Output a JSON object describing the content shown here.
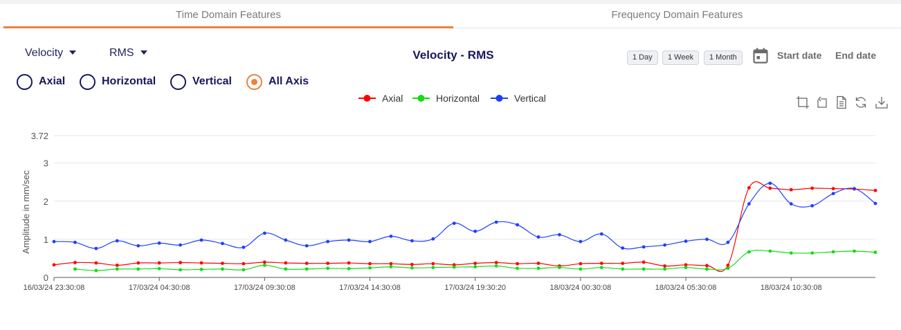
{
  "tabs": [
    {
      "label": "Time Domain Features"
    },
    {
      "label": "Frequency Domain Features"
    }
  ],
  "dropdowns": {
    "parameter": "Velocity",
    "feature": "RMS"
  },
  "chart_title": "Velocity - RMS",
  "range_buttons": [
    "1 Day",
    "1 Week",
    "1 Month"
  ],
  "date_range": {
    "start": "Start date",
    "end": "End date"
  },
  "axis_options": [
    {
      "label": "Axial",
      "selected": false
    },
    {
      "label": "Horizontal",
      "selected": false
    },
    {
      "label": "Vertical",
      "selected": false
    },
    {
      "label": "All Axis",
      "selected": true
    }
  ],
  "accent_color": "#e8833a",
  "toolbox": [
    "zoom-icon",
    "zoom-reset-icon",
    "data-view-icon",
    "restore-icon",
    "save-image-icon"
  ],
  "chart_data": {
    "type": "line",
    "ylabel": "Amplitude in mm/sec",
    "xlabel": "",
    "ylim": [
      0,
      3.72
    ],
    "yticks": [
      "0",
      "1",
      "2",
      "3",
      "3.72"
    ],
    "xticks": [
      "16/03/24 23:30:08",
      "17/03/24 04:30:08",
      "17/03/24 09:30:08",
      "17/03/24 14:30:08",
      "17/03/24 19:30:20",
      "18/03/24 00:30:08",
      "18/03/24 05:30:08",
      "18/03/24 10:30:08"
    ],
    "x_range_hours": [
      0,
      39
    ],
    "legend_position": "top-center",
    "grid": true,
    "smooth": true,
    "series": [
      {
        "name": "Axial",
        "color": "#ff0000",
        "x": [
          0,
          1,
          2,
          3,
          4,
          5,
          6,
          7,
          8,
          9,
          10,
          11,
          12,
          13,
          14,
          15,
          16,
          17,
          18,
          19,
          20,
          21,
          22,
          23,
          24,
          25,
          26,
          27,
          28,
          29,
          30,
          31,
          32,
          33,
          34,
          35,
          36,
          37,
          38,
          39
        ],
        "values": [
          0.33,
          0.39,
          0.38,
          0.32,
          0.38,
          0.38,
          0.39,
          0.38,
          0.37,
          0.36,
          0.4,
          0.38,
          0.37,
          0.37,
          0.38,
          0.36,
          0.36,
          0.34,
          0.36,
          0.33,
          0.37,
          0.39,
          0.36,
          0.37,
          0.3,
          0.36,
          0.37,
          0.37,
          0.4,
          0.3,
          0.33,
          0.31,
          0.32,
          2.35,
          2.34,
          2.3,
          2.34,
          2.33,
          2.32,
          2.28
        ]
      },
      {
        "name": "Horizontal",
        "color": "#11dd11",
        "x": [
          1,
          2,
          3,
          4,
          5,
          6,
          7,
          8,
          9,
          10,
          11,
          12,
          13,
          14,
          15,
          16,
          17,
          18,
          19,
          20,
          21,
          22,
          23,
          24,
          25,
          26,
          27,
          28,
          29,
          30,
          31,
          32,
          33,
          34,
          35,
          36,
          37,
          38,
          39
        ],
        "values": [
          0.22,
          0.18,
          0.22,
          0.22,
          0.23,
          0.2,
          0.21,
          0.22,
          0.2,
          0.32,
          0.22,
          0.22,
          0.24,
          0.23,
          0.25,
          0.28,
          0.25,
          0.26,
          0.27,
          0.28,
          0.3,
          0.24,
          0.24,
          0.26,
          0.22,
          0.26,
          0.22,
          0.22,
          0.22,
          0.26,
          0.22,
          0.24,
          0.67,
          0.69,
          0.64,
          0.64,
          0.67,
          0.69,
          0.66
        ]
      },
      {
        "name": "Vertical",
        "color": "#1f3dff",
        "x": [
          0,
          1,
          2,
          3,
          4,
          5,
          6,
          7,
          8,
          9,
          10,
          11,
          12,
          13,
          14,
          15,
          16,
          17,
          18,
          19,
          20,
          21,
          22,
          23,
          24,
          25,
          26,
          27,
          28,
          29,
          30,
          31,
          32,
          33,
          34,
          35,
          36,
          37,
          38,
          39
        ],
        "values": [
          0.94,
          0.92,
          0.76,
          0.96,
          0.83,
          0.9,
          0.85,
          0.98,
          0.89,
          0.79,
          1.16,
          0.98,
          0.83,
          0.94,
          0.98,
          0.94,
          1.08,
          0.96,
          1.01,
          1.42,
          1.21,
          1.45,
          1.38,
          1.06,
          1.12,
          0.94,
          1.14,
          0.77,
          0.8,
          0.85,
          0.95,
          1.0,
          0.92,
          1.93,
          2.47,
          1.93,
          1.88,
          2.2,
          2.33,
          1.94
        ]
      }
    ]
  }
}
